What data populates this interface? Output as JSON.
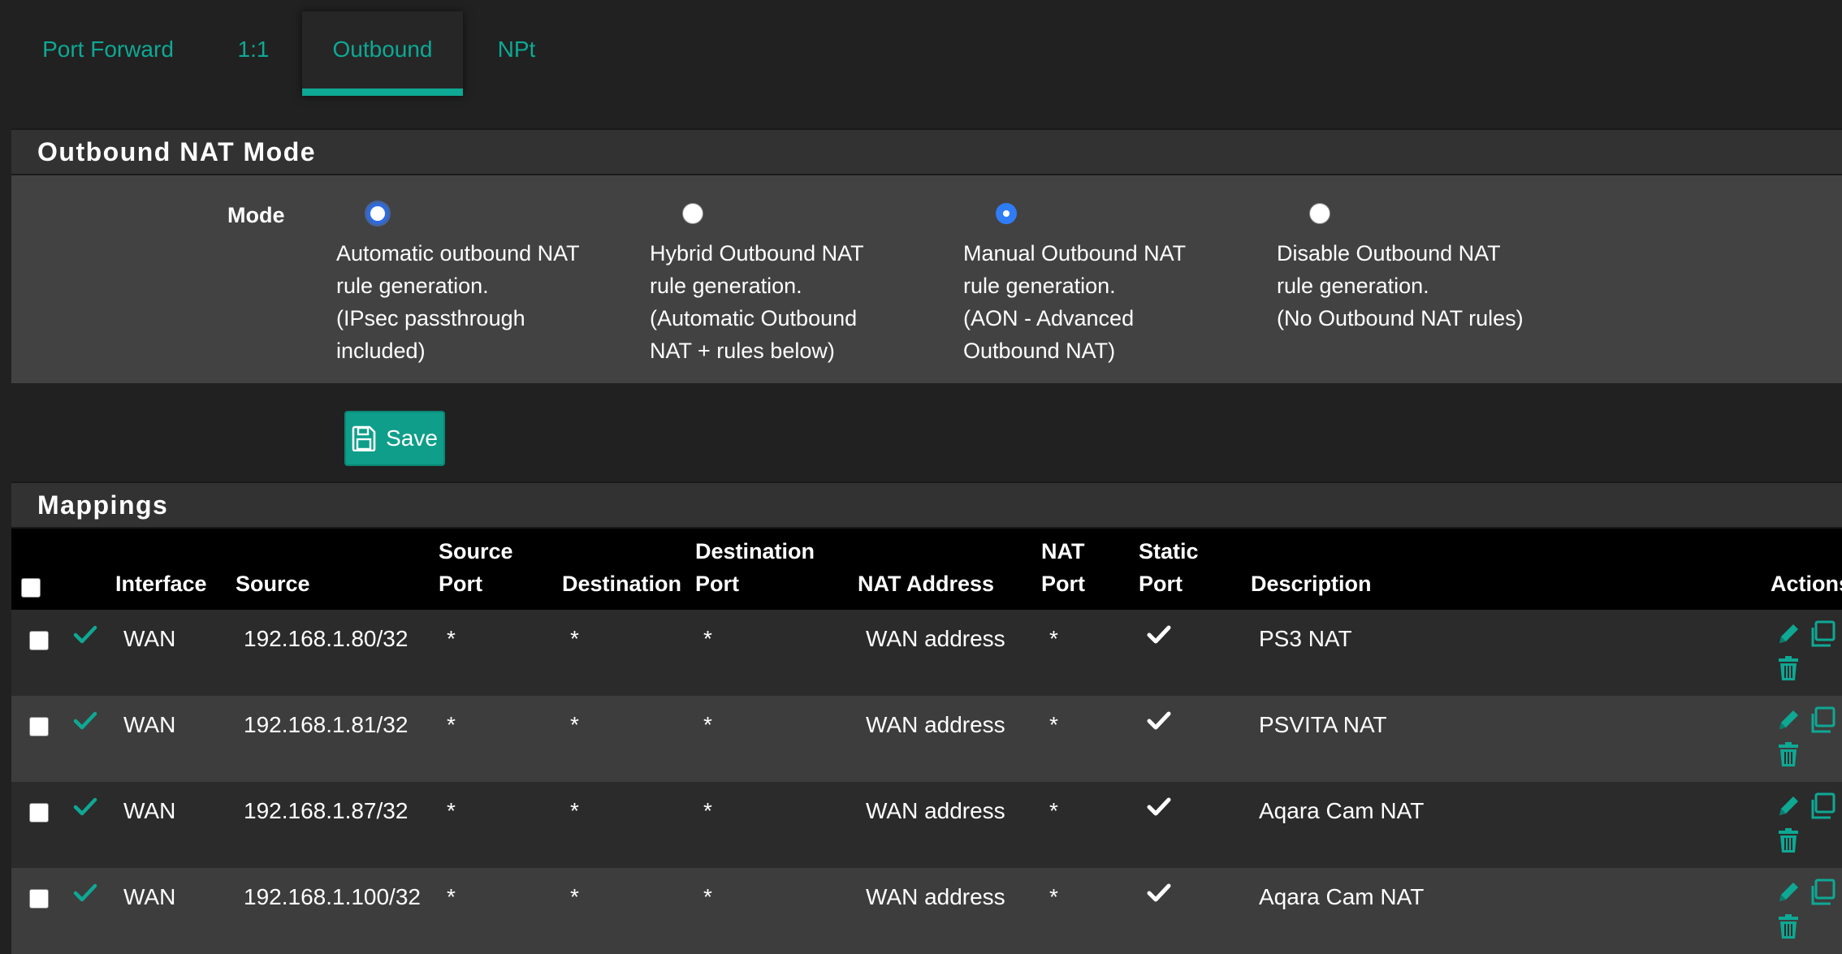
{
  "tabs": [
    {
      "label": "Port Forward",
      "active": false
    },
    {
      "label": "1:1",
      "active": false
    },
    {
      "label": "Outbound",
      "active": true
    },
    {
      "label": "NPt",
      "active": false
    }
  ],
  "mode_panel": {
    "title": "Outbound NAT Mode",
    "mode_label": "Mode",
    "options": [
      {
        "lines": [
          "Automatic outbound NAT",
          "rule generation.",
          "(IPsec passthrough",
          "included)"
        ],
        "selected": false
      },
      {
        "lines": [
          "Hybrid Outbound NAT",
          "rule generation.",
          "(Automatic Outbound",
          "NAT + rules below)"
        ],
        "selected": false
      },
      {
        "lines": [
          "Manual Outbound NAT",
          "rule generation.",
          "(AON - Advanced",
          "Outbound NAT)"
        ],
        "selected": true
      },
      {
        "lines": [
          "Disable Outbound NAT",
          "rule generation.",
          "(No Outbound NAT rules)"
        ],
        "selected": false
      }
    ]
  },
  "save_button": {
    "label": "Save"
  },
  "mappings": {
    "title": "Mappings",
    "columns": {
      "interface": "Interface",
      "source": "Source",
      "source_port": [
        "Source",
        "Port"
      ],
      "destination": "Destination",
      "destination_port": [
        "Destination",
        "Port"
      ],
      "nat_address": "NAT Address",
      "nat_port": [
        "NAT",
        "Port"
      ],
      "static_port": [
        "Static",
        "Port"
      ],
      "description": "Description",
      "actions": "Actions"
    },
    "rows": [
      {
        "interface": "WAN",
        "source": "192.168.1.80/32",
        "source_port": "*",
        "destination": "*",
        "destination_port": "*",
        "nat_address": "WAN address",
        "nat_port": "*",
        "description": "PS3 NAT"
      },
      {
        "interface": "WAN",
        "source": "192.168.1.81/32",
        "source_port": "*",
        "destination": "*",
        "destination_port": "*",
        "nat_address": "WAN address",
        "nat_port": "*",
        "description": "PSVITA NAT"
      },
      {
        "interface": "WAN",
        "source": "192.168.1.87/32",
        "source_port": "*",
        "destination": "*",
        "destination_port": "*",
        "nat_address": "WAN address",
        "nat_port": "*",
        "description": "Aqara Cam NAT"
      },
      {
        "interface": "WAN",
        "source": "192.168.1.100/32",
        "source_port": "*",
        "destination": "*",
        "destination_port": "*",
        "nat_address": "WAN address",
        "nat_port": "*",
        "description": "Aqara Cam NAT"
      }
    ]
  },
  "colors": {
    "accent": "#0ea894",
    "background": "#212121",
    "panel": "#424242",
    "radio_selected": "#2f7cf6"
  },
  "icons": {
    "save": "floppy-disk-icon",
    "enabled": "check-icon",
    "static_port": "check-icon",
    "edit": "pencil-icon",
    "copy": "copy-icon",
    "delete": "trash-icon"
  }
}
